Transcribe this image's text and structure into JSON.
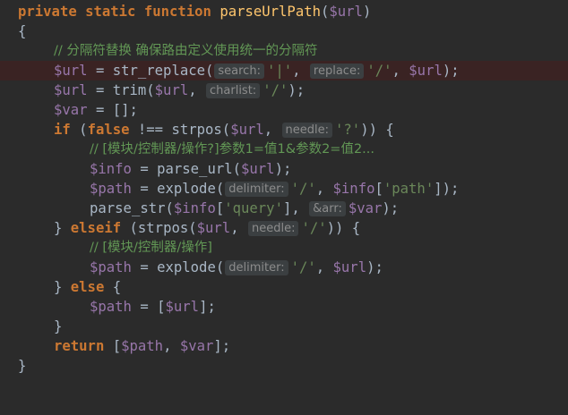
{
  "editor": {
    "lines": {
      "l1": {
        "kw1": "private static function",
        "fn": "parseUrlPath",
        "p1": "(",
        "var": "$url",
        "p2": ")"
      },
      "l2": {
        "t": "{"
      },
      "l3": {
        "cm": "// 分隔符替换 确保路由定义使用统一的分隔符"
      },
      "l4": {
        "var": "$url",
        "t1": " = str_replace(",
        "hint1": "search:",
        "s1": "'|'",
        "t2": ", ",
        "hint2": "replace:",
        "s2": "'/'",
        "t3": ", ",
        "var2": "$url",
        "t4": ");"
      },
      "l5": {
        "var": "$url",
        "t1": " = trim(",
        "var2": "$url",
        "t2": ", ",
        "hint1": "charlist:",
        "s1": "'/'",
        "t3": ");"
      },
      "l6": {
        "var": "$var",
        "t1": " = [];"
      },
      "l7": {
        "kw1": "if",
        "t1": " (",
        "kw2": "false",
        "t2": " !== strpos(",
        "var": "$url",
        "t3": ", ",
        "hint1": "needle:",
        "s1": "'?'",
        "t4": ")) {"
      },
      "l8": {
        "cm": "// [模块/控制器/操作?]参数1=值1&参数2=值2..."
      },
      "l9": {
        "var": "$info",
        "t1": " = parse_url(",
        "var2": "$url",
        "t2": ");"
      },
      "l10": {
        "var": "$path",
        "t1": " = explode(",
        "hint1": "delimiter:",
        "s1": "'/'",
        "t2": ", ",
        "var2": "$info",
        "t3": "[",
        "s2": "'path'",
        "t4": "]);"
      },
      "l11": {
        "t1": "parse_str(",
        "var": "$info",
        "t2": "[",
        "s1": "'query'",
        "t3": "], ",
        "hint1": "&arr:",
        "var2": "$var",
        "t4": ");"
      },
      "l12": {
        "t1": "} ",
        "kw1": "elseif",
        "t2": " (strpos(",
        "var": "$url",
        "t3": ", ",
        "hint1": "needle:",
        "s1": "'/'",
        "t4": ")) {"
      },
      "l13": {
        "cm": "// [模块/控制器/操作]"
      },
      "l14": {
        "var": "$path",
        "t1": " = explode(",
        "hint1": "delimiter:",
        "s1": "'/'",
        "t2": ", ",
        "var2": "$url",
        "t3": ");"
      },
      "l15": {
        "t1": "} ",
        "kw1": "else",
        "t2": " {"
      },
      "l16": {
        "var": "$path",
        "t1": " = [",
        "var2": "$url",
        "t2": "];"
      },
      "l17": {
        "t": "}"
      },
      "l18": {
        "kw1": "return",
        "t1": " [",
        "var": "$path",
        "t2": ", ",
        "var2": "$var",
        "t3": "];"
      },
      "l19": {
        "t": "}"
      }
    }
  },
  "colors": {
    "background": "#2b2b2b",
    "keyword": "#cc7832",
    "function_name": "#ffc66d",
    "variable": "#9876aa",
    "string": "#6a8759",
    "comment": "#808080",
    "highlight_line": "#3a2323",
    "hint_background": "#3b3f41"
  }
}
